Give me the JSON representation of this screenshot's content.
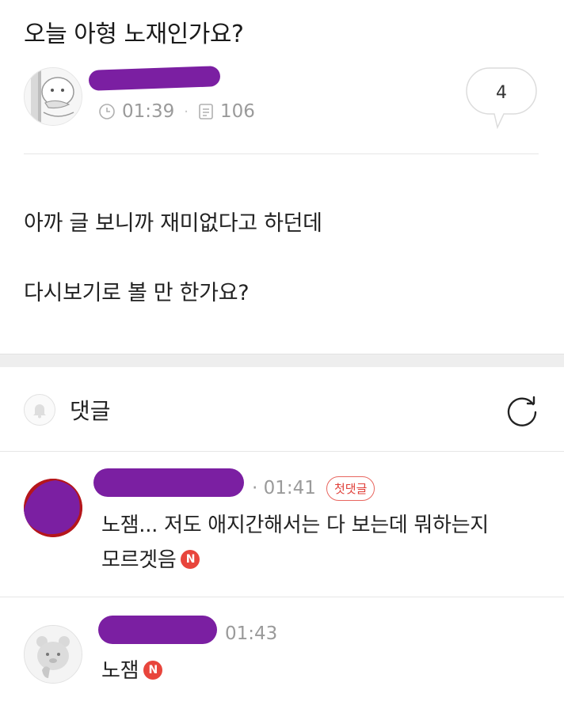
{
  "post": {
    "title": "오늘 아형 노재인가요?",
    "time": "01:39",
    "views": "106",
    "comment_count": "4",
    "body": [
      "아까 글 보니까 재미없다고 하던데",
      "다시보기로 볼 만 한가요?"
    ]
  },
  "comments_section": {
    "label": "댓글"
  },
  "comments": [
    {
      "time": "01:41",
      "badge": "첫댓글",
      "lines": [
        "노잼... 저도 애지간해서는 다 보는데 뭐하는지",
        "모르겟음"
      ],
      "new_badge": "N"
    },
    {
      "time": "01:43",
      "lines": [
        "노잼"
      ],
      "new_badge": "N"
    }
  ],
  "icons": {
    "clock": "clock-icon",
    "views": "document-icon",
    "bell": "bell-icon",
    "refresh": "refresh-icon"
  },
  "colors": {
    "redaction": "#7b1fa2",
    "badge_red": "#e8453c"
  }
}
